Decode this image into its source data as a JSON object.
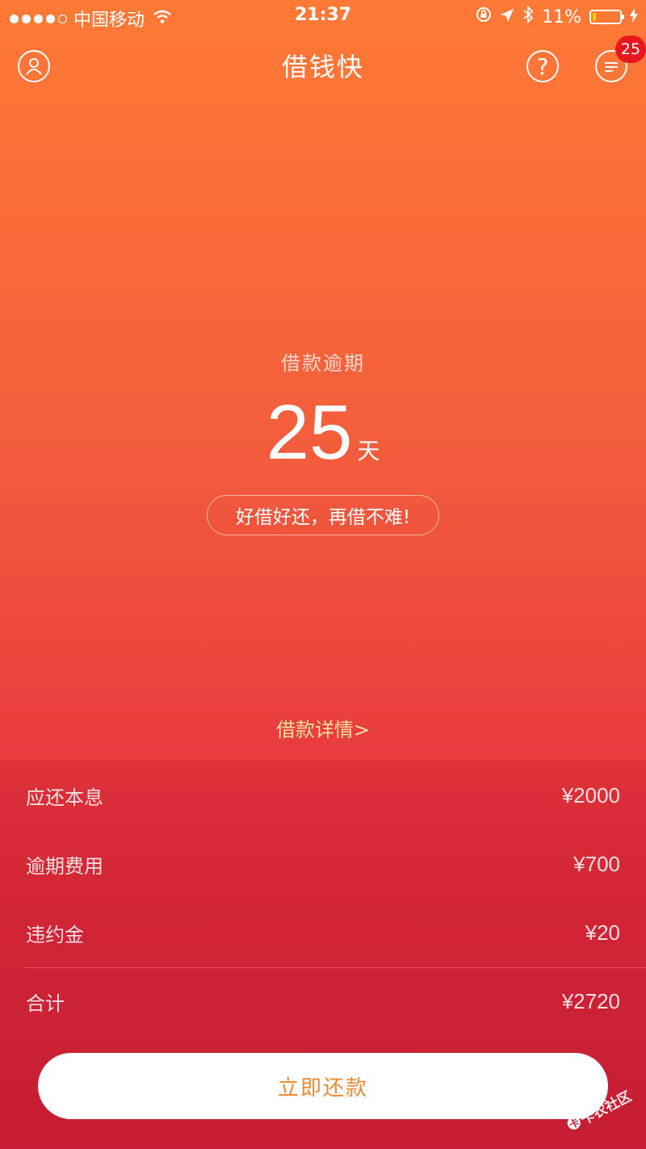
{
  "status_bar": {
    "carrier": "中国移动",
    "time": "21:37",
    "battery": "11%",
    "battery_level": 0.11,
    "icons": [
      "wifi-icon",
      "orientation-lock-icon",
      "location-icon",
      "bluetooth-icon",
      "charging-icon"
    ]
  },
  "nav": {
    "title": "借钱快",
    "profile_icon": "person-icon",
    "help_icon": "question-icon",
    "help_symbol": "?",
    "message_icon": "message-icon",
    "message_badge": "25"
  },
  "overdue": {
    "label": "借款逾期",
    "days": "25",
    "unit": "天",
    "slogan": "好借好还，再借不难!"
  },
  "details_link": "借款详情>",
  "fees": [
    {
      "label": "应还本息",
      "value": "¥2000"
    },
    {
      "label": "逾期费用",
      "value": "¥700"
    },
    {
      "label": "违约金",
      "value": "¥20"
    }
  ],
  "total": {
    "label": "合计",
    "value": "¥2720"
  },
  "repay_button": "立即还款",
  "watermark": "卡农社区",
  "colors": {
    "gradient_top": "#FF7A36",
    "gradient_bottom": "#C51F37",
    "button_text": "#F08A2F",
    "details_link": "#FFE39A",
    "badge": "#E8171D"
  }
}
